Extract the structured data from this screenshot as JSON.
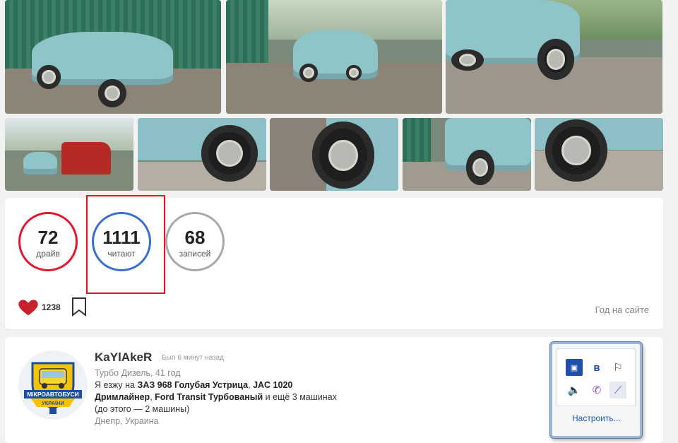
{
  "stats": [
    {
      "value": "72",
      "label": "драйв",
      "color": "#e3162b"
    },
    {
      "value": "1111",
      "label": "читают",
      "color": "#3a6ed0"
    },
    {
      "value": "68",
      "label": "записей",
      "color": "#a8a8a8"
    }
  ],
  "likes": {
    "count": "1238",
    "heart_color": "#c8232c"
  },
  "year_on_site": "Год на сайте",
  "profile": {
    "username": "KaYlAkeR",
    "last_seen": "Был 6 минут назад",
    "line1": "Турбо Дизель, 41 год",
    "drives_prefix": "Я езжу на",
    "car1": "ЗАЗ 968 Голубая Устрица",
    "car2": "JAC 1020",
    "car3": "Дримлайнер",
    "car4": "Ford Transit Турбованый",
    "drives_suffix": "и ещё 3 машинах",
    "previous": "(до этого — 2 машины)",
    "location": "Днепр, Украина",
    "avatar_text_top": "МІКРОАВТОБУСИ",
    "avatar_text_bottom": "УКРАЇНИ"
  },
  "tray": {
    "icons": [
      "display-icon",
      "bluetooth-icon",
      "flag-icon",
      "speaker-icon",
      "viber-icon",
      "pen-icon"
    ],
    "customize_label": "Настроить..."
  }
}
